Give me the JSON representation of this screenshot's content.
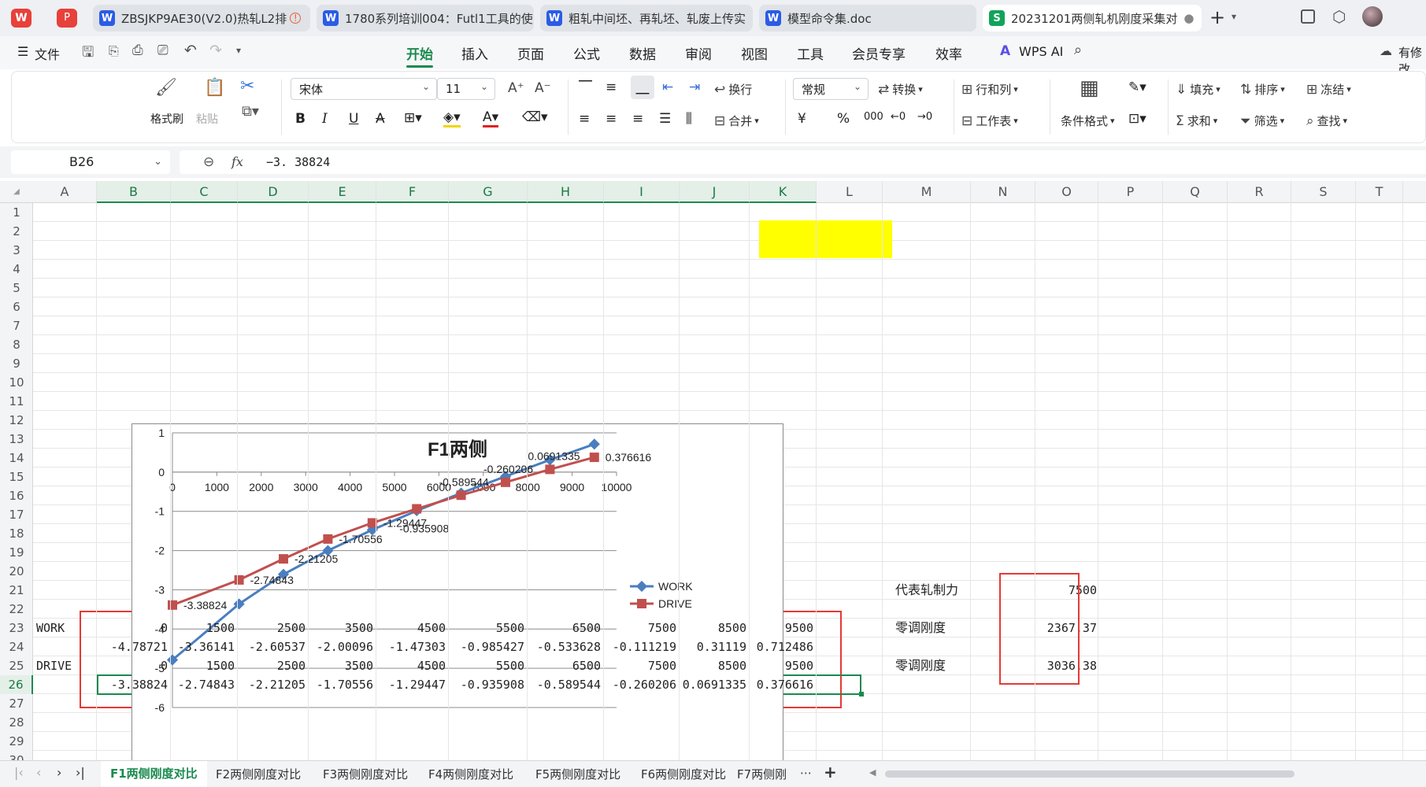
{
  "browser_tabs": [
    {
      "icon": "W",
      "title": "ZBSJKP9AE30(V2.0)热轧L2排",
      "warn": "!"
    },
    {
      "icon": "W",
      "title": "1780系列培训004：Futl1工具的使"
    },
    {
      "icon": "W",
      "title": "粗轧中间坯、再轧坯、轧废上传实"
    },
    {
      "icon": "W",
      "title": "模型命令集.doc"
    },
    {
      "icon": "S",
      "title": "20231201两侧轧机刚度采集对",
      "active": true
    }
  ],
  "menu": {
    "file": "文件",
    "tabs": [
      "开始",
      "插入",
      "页面",
      "公式",
      "数据",
      "审阅",
      "视图",
      "工具",
      "会员专享",
      "效率"
    ],
    "active_tab": "开始",
    "wps_ai": "WPS AI",
    "right": "有修改"
  },
  "ribbon": {
    "format_painter": "格式刷",
    "paste": "粘贴",
    "font_name": "宋体",
    "font_size": "11",
    "bold": "B",
    "italic": "I",
    "underline": "U",
    "wrap": "换行",
    "number_format": "常规",
    "convert": "转换",
    "row_col": "行和列",
    "merge": "合并",
    "worksheet": "工作表",
    "conditional_format": "条件格式",
    "fill": "填充",
    "sort": "排序",
    "freeze": "冻结",
    "sum": "求和",
    "filter": "筛选",
    "find": "查找",
    "currency": "¥",
    "percent": "%"
  },
  "formula_bar": {
    "name_box": "B26",
    "fx": "fx",
    "formula": "−3. 38824"
  },
  "columns": [
    "A",
    "B",
    "C",
    "D",
    "E",
    "F",
    "G",
    "H",
    "I",
    "J",
    "K",
    "L",
    "M",
    "N",
    "O",
    "P",
    "Q",
    "R",
    "S",
    "T"
  ],
  "rows": [
    "1",
    "2",
    "3",
    "4",
    "5",
    "6",
    "7",
    "8",
    "9",
    "10",
    "11",
    "12",
    "13",
    "14",
    "15",
    "16",
    "17",
    "18",
    "19",
    "20",
    "21",
    "22",
    "23",
    "24",
    "25",
    "26",
    "27",
    "28",
    "29",
    "30"
  ],
  "cells": {
    "A23": "WORK",
    "A25": "DRIVE",
    "row23": [
      "0",
      "1500",
      "2500",
      "3500",
      "4500",
      "5500",
      "6500",
      "7500",
      "8500",
      "9500"
    ],
    "row24": [
      "-4.78721",
      "-3.36141",
      "-2.60537",
      "-2.00096",
      "-1.47303",
      "-0.985427",
      "-0.533628",
      "-0.111219",
      "0.31119",
      "0.712486"
    ],
    "row25": [
      "0",
      "1500",
      "2500",
      "3500",
      "4500",
      "5500",
      "6500",
      "7500",
      "8500",
      "9500"
    ],
    "row26": [
      "-3.38824",
      "-2.74843",
      "-2.21205",
      "-1.70556",
      "-1.29447",
      "-0.935908",
      "-0.589544",
      "-0.260206",
      "0.0691335",
      "0.376616"
    ],
    "M21": "代表轧制力",
    "N21": "7500",
    "M23": "零调刚度",
    "N23": "2367.37",
    "M25": "零调刚度",
    "N25": "3036.38"
  },
  "sheet_tabs": [
    "F1两侧刚度对比",
    "F2两侧刚度对比",
    "F3两侧刚度对比",
    "F4两侧刚度对比",
    "F5两侧刚度对比",
    "F6两侧刚度对比",
    "F7两侧刚"
  ],
  "active_sheet": "F1两侧刚度对比",
  "colors": {
    "accent": "#1a8a4f",
    "work": "#4a7ebf",
    "drive": "#c0504d",
    "highlight": "#ffff00",
    "annotation": "#e53935"
  },
  "chart_data": {
    "type": "line",
    "title": "F1两侧",
    "x": [
      0,
      1500,
      2500,
      3500,
      4500,
      5500,
      6500,
      7500,
      8500,
      9500
    ],
    "series": [
      {
        "name": "WORK",
        "values": [
          -4.78721,
          -3.36141,
          -2.60537,
          -2.00096,
          -1.47303,
          -0.985427,
          -0.533628,
          -0.111219,
          0.31119,
          0.712486
        ]
      },
      {
        "name": "DRIVE",
        "values": [
          -3.38824,
          -2.74843,
          -2.21205,
          -1.70556,
          -1.29447,
          -0.935908,
          -0.589544,
          -0.260206,
          0.0691335,
          0.376616
        ]
      }
    ],
    "data_labels": [
      "-3.38824",
      "-2.74843",
      "-2.21205",
      "-1.70556",
      "-1.29447",
      "-0.935908",
      "-0.589544",
      "-0.260206",
      "0.0691335",
      "0.376616"
    ],
    "xlim": [
      0,
      10000
    ],
    "ylim": [
      -6,
      1
    ],
    "xticks": [
      "0",
      "1000",
      "2000",
      "3000",
      "4000",
      "5000",
      "6000",
      "7000",
      "8000",
      "9000",
      "10000"
    ],
    "yticks": [
      "1",
      "0",
      "-1",
      "-2",
      "-3",
      "-4",
      "-5",
      "-6"
    ],
    "grid": true,
    "legend": "right"
  }
}
